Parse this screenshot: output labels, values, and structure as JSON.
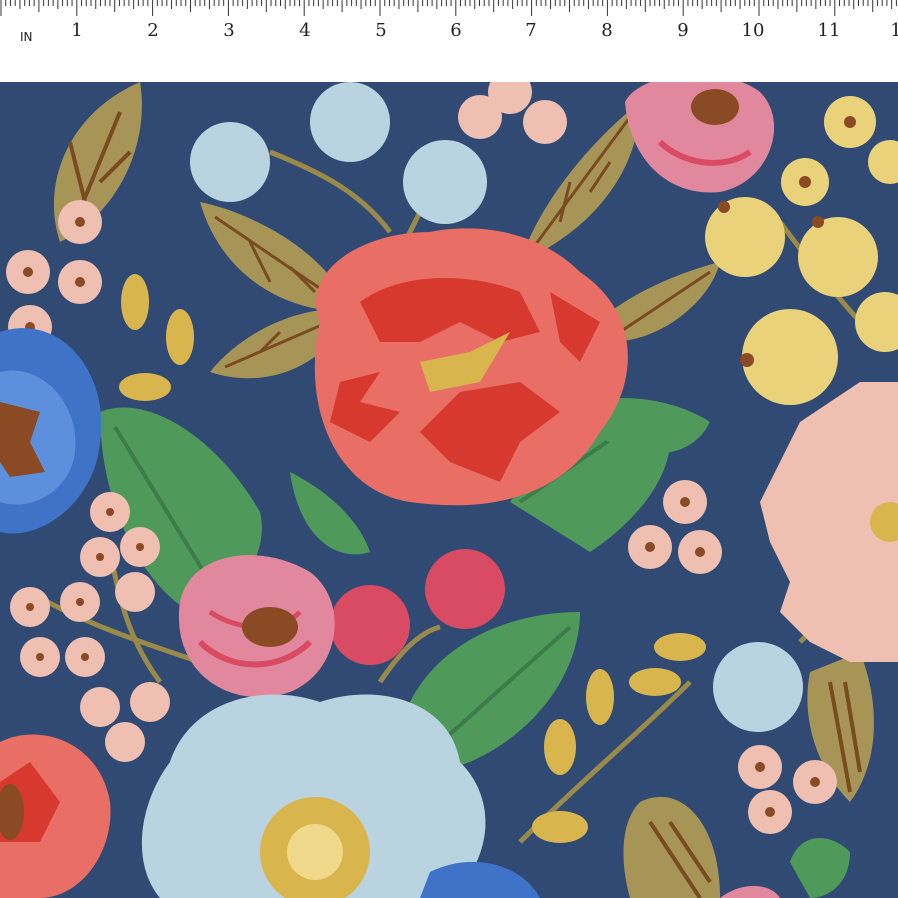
{
  "ruler": {
    "unit": "IN",
    "labels": [
      "1",
      "2",
      "3",
      "4",
      "5",
      "6",
      "7",
      "8",
      "9",
      "10",
      "11",
      "1"
    ]
  },
  "colors": {
    "background": "#304a74",
    "pink_rose": "#e2889e",
    "coral_rose": "#e86e66",
    "red": "#d8392e",
    "gold": "#d9b64d",
    "leaf_green": "#4f9a5a",
    "leaf_tan": "#a79557",
    "light_blue": "#b9d4e0",
    "blue_flower": "#3f73c8",
    "blush": "#efbfb2",
    "yellow_berry": "#e9d27a",
    "brown": "#8a4a24"
  }
}
